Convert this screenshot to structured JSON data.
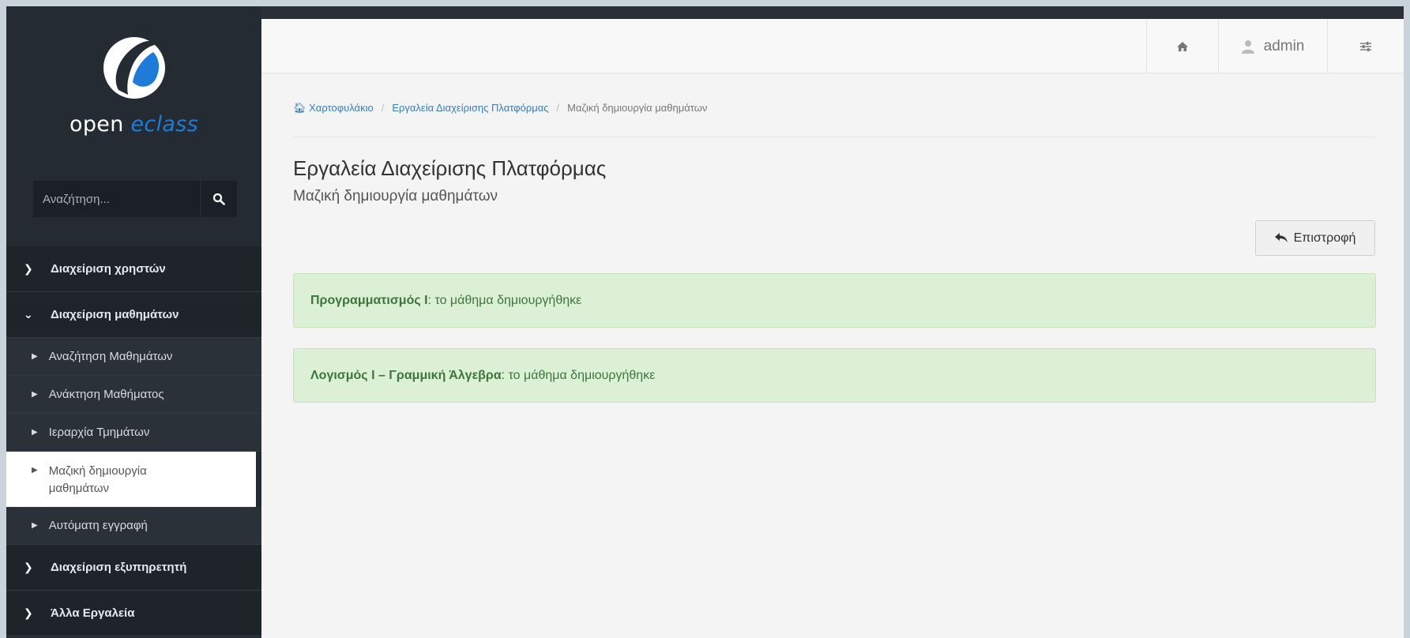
{
  "sidebar": {
    "logo": {
      "text_main": "open ",
      "text_accent": "eclass"
    },
    "search": {
      "placeholder": "Αναζήτηση..."
    },
    "menu": [
      {
        "type": "section",
        "label": "Διαχείριση χρηστών",
        "expanded": false
      },
      {
        "type": "section",
        "label": "Διαχείριση μαθημάτων",
        "expanded": true
      },
      {
        "type": "sub",
        "label": "Αναζήτηση Μαθημάτων"
      },
      {
        "type": "sub",
        "label": "Ανάκτηση Μαθήματος"
      },
      {
        "type": "sub",
        "label": "Ιεραρχία Τμημάτων"
      },
      {
        "type": "sub",
        "label": "Μαζική δημιουργία μαθημάτων",
        "active": true
      },
      {
        "type": "sub",
        "label": "Αυτόματη εγγραφή"
      },
      {
        "type": "section",
        "label": "Διαχείριση εξυπηρετητή",
        "expanded": false
      },
      {
        "type": "section",
        "label": "Άλλα Εργαλεία",
        "expanded": false
      }
    ],
    "active_item_line1": "Μαζική δημιουργία",
    "active_item_line2": "μαθημάτων"
  },
  "topbar": {
    "home_icon": "home-icon",
    "user_icon": "user-icon",
    "username": "admin",
    "settings_icon": "sliders-icon"
  },
  "breadcrumb": {
    "items": [
      "Χαρτοφυλάκιο",
      "Εργαλεία Διαχείρισης Πλατφόρμας"
    ],
    "current": "Μαζική δημιουργία μαθημάτων"
  },
  "page": {
    "title": "Εργαλεία Διαχείρισης Πλατφόρμας",
    "subtitle": "Μαζική δημιουργία μαθημάτων",
    "back_label": "Επιστροφή"
  },
  "alerts": [
    {
      "course": "Προγραμματισμός Ι",
      "message": ": το μάθημα δημιουργήθηκε"
    },
    {
      "course": "Λογισμός Ι – Γραμμική Άλγεβρα",
      "message": ": το μάθημα δημιουργήθηκε"
    }
  ],
  "colors": {
    "sidebar_bg": "#252b33",
    "accent_blue": "#1f7bd8",
    "alert_bg": "#dcf0d6",
    "alert_text": "#3c763d"
  }
}
